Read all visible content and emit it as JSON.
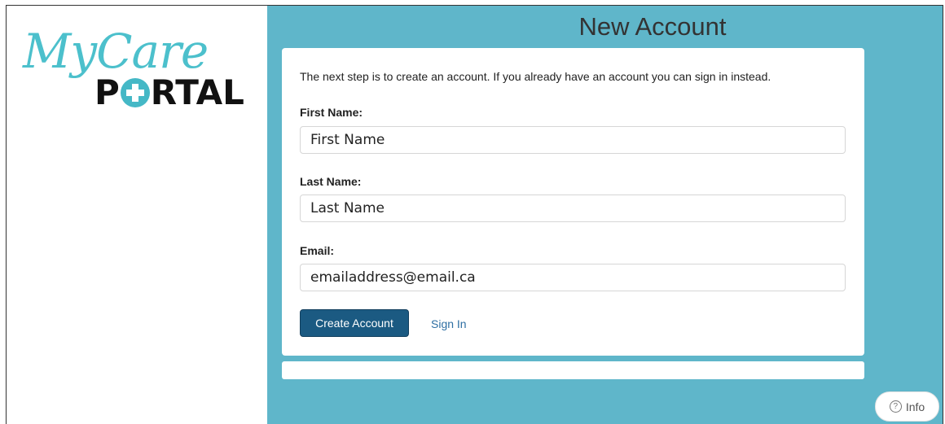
{
  "brand": {
    "logo_script": "MyCare",
    "logo_portal_left": "P",
    "logo_portal_right": "RTAL"
  },
  "page": {
    "title": "New Account",
    "intro": "The next step is to create an account. If you already have an account you can sign in instead."
  },
  "form": {
    "first_name_label": "First Name:",
    "first_name_value": "First Name",
    "last_name_label": "Last Name:",
    "last_name_value": "Last Name",
    "email_label": "Email:",
    "email_value": "emailaddress@email.ca"
  },
  "actions": {
    "create_account": "Create Account",
    "sign_in": "Sign In"
  },
  "info": {
    "label": "Info",
    "icon": "?"
  },
  "colors": {
    "accent_teal": "#5fb6ca",
    "primary_button": "#1b5a82",
    "link": "#2e6fa3"
  }
}
